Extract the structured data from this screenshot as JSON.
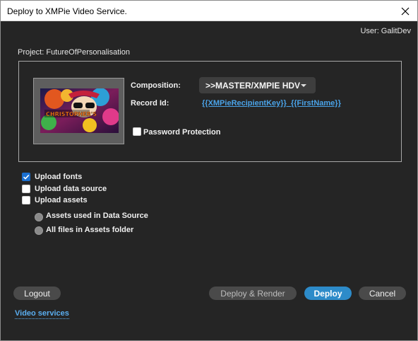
{
  "window": {
    "title": "Deploy to XMPie Video Service."
  },
  "user": {
    "label": "User: GalitDev"
  },
  "project": {
    "label": "Project: FutureOfPersonalisation"
  },
  "panel": {
    "thumbnail_text": "CHRISTOPHER'S",
    "composition_label": "Composition:",
    "composition_value": ">>MASTER/XMPIE HDV",
    "record_id_label": "Record Id:",
    "record_id_value": "{{XMPieRecipientKey}}_{{FirstName}}",
    "password_label": "Password Protection",
    "password_checked": false
  },
  "options": {
    "upload_fonts": {
      "label": "Upload fonts",
      "checked": true
    },
    "upload_data_source": {
      "label": "Upload data source",
      "checked": false
    },
    "upload_assets": {
      "label": "Upload assets",
      "checked": false
    },
    "assets_in_data_source": {
      "label": "Assets used in Data Source",
      "disabled": true
    },
    "all_files_in_assets": {
      "label": "All files in Assets folder",
      "disabled": true
    }
  },
  "buttons": {
    "logout": "Logout",
    "deploy_render": "Deploy & Render",
    "deploy": "Deploy",
    "cancel": "Cancel"
  },
  "footer": {
    "video_services_link": "Video services"
  },
  "colors": {
    "background": "#252525",
    "accent": "#2d8bc9",
    "link": "#5aaef0",
    "checkbox_checked": "#1a6fd0"
  },
  "icons": {
    "close": "close-icon",
    "dropdown": "chevron-down-icon",
    "check": "check-icon"
  }
}
